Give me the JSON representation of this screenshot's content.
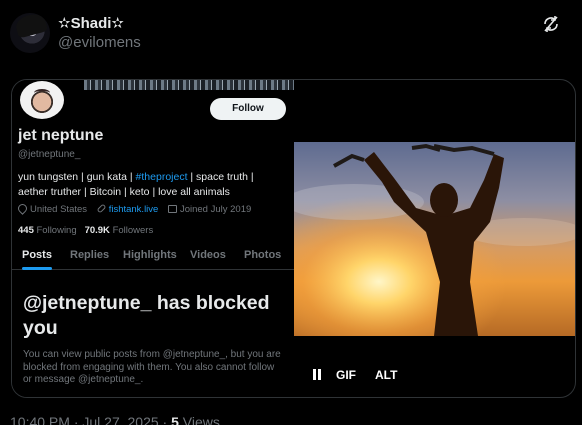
{
  "post": {
    "display_name": "✫Shadi✫",
    "handle": "@evilomens"
  },
  "profile": {
    "follow_label": "Follow",
    "name": "jet neptune",
    "handle": "@jetneptune_",
    "bio_before": "yun tungsten | gun kata | ",
    "bio_tag": "#theproject",
    "bio_after": " | space truth | aether truther | Bitcoin | keto | love all animals",
    "location": "United States",
    "website": "fishtank.live",
    "joined": "Joined July 2019",
    "following_count": "445",
    "following_label": "Following",
    "followers_count": "70.9K",
    "followers_label": "Followers",
    "tabs": [
      "Posts",
      "Replies",
      "Highlights",
      "Videos",
      "Photos"
    ],
    "blocked_title": "@jetneptune_ has blocked you",
    "blocked_text": "You can view public posts from @jetneptune_, but you are blocked from engaging with them. You also cannot follow or message @jetneptune_."
  },
  "media": {
    "gif_label": "GIF",
    "alt_label": "ALT"
  },
  "footer": {
    "time": "10:40 PM · Jul 27, 2025",
    "views_count": "5",
    "views_label": "Views"
  },
  "icons": {
    "top_right": "sync-slash-icon",
    "location": "location-pin-icon",
    "website": "link-icon",
    "joined": "calendar-icon",
    "pause": "pause-icon"
  },
  "colors": {
    "accent": "#1d9bf0",
    "muted": "#71767b",
    "background": "#000000",
    "text": "#e7e9ea"
  }
}
